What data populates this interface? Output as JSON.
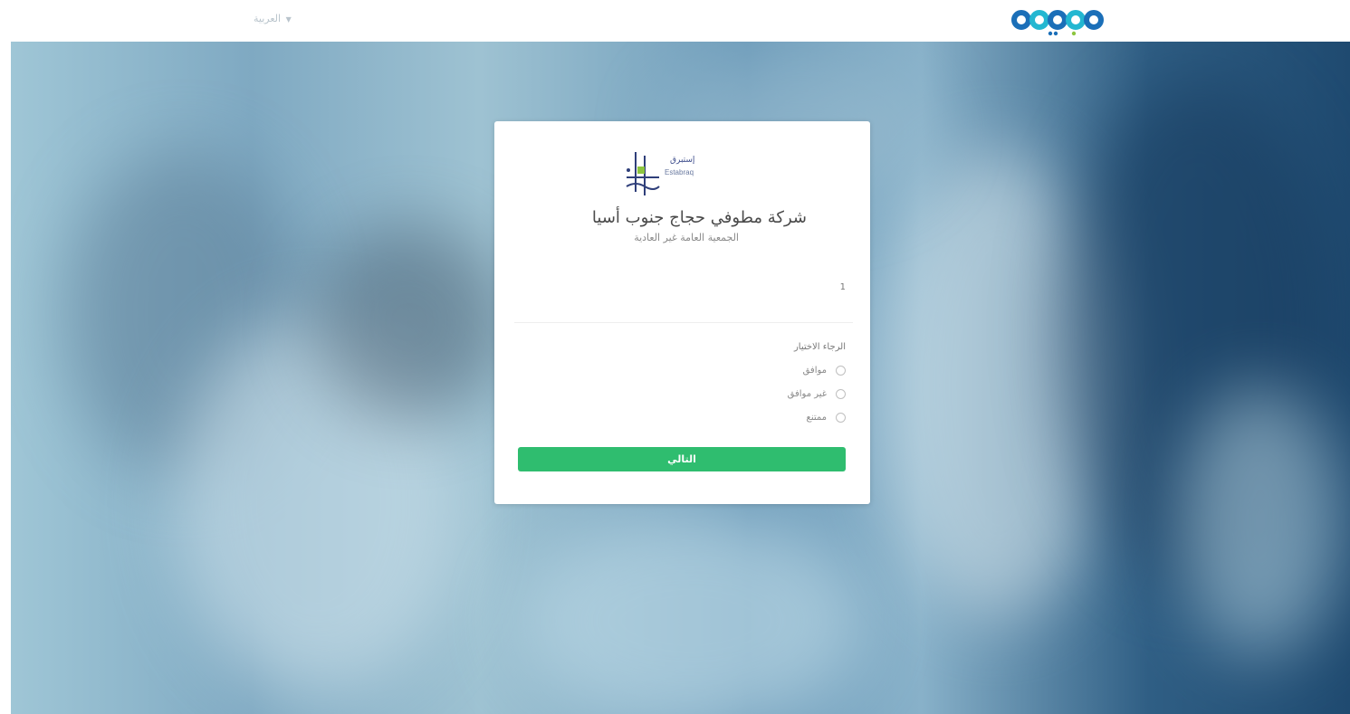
{
  "header": {
    "language_menu_label": "العربية"
  },
  "card": {
    "org_title": "شركة مطوفي حجاج جنوب أسيا",
    "org_subtitle": "الجمعية العامة غير العادية",
    "org_logo_arabic": "إستبرق",
    "org_logo_latin": "Estabraq",
    "field_number": "1",
    "code_field": {
      "value": "",
      "placeholder": ""
    },
    "choose_label": "الرجاء الاختيار",
    "options": [
      {
        "label": "موافق"
      },
      {
        "label": "غير موافق"
      },
      {
        "label": "ممتنع"
      }
    ],
    "next_label": "التالي"
  },
  "colors": {
    "primary_button": "#2fbd6f",
    "logo_navy": "#1b3f8a",
    "logo_teal": "#23b7d1",
    "logo_green": "#8dc63f"
  }
}
